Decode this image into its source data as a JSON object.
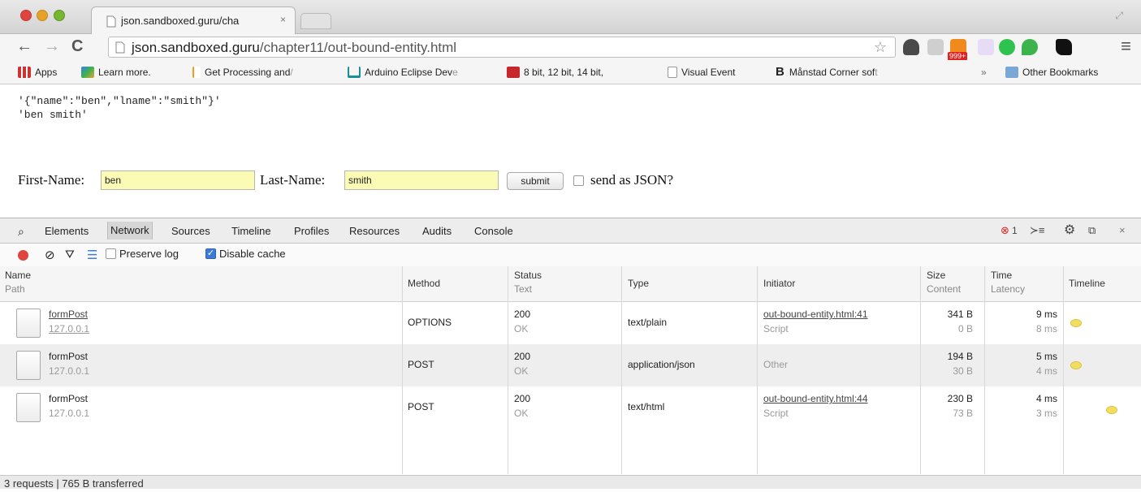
{
  "browser": {
    "tab_title": "json.sandboxed.guru/cha",
    "tab_close": "×",
    "url_host": "json.sandboxed.guru",
    "url_path": "/chapter11/out-bound-entity.html",
    "extension_badge": "999+",
    "extensions": [
      "pocket-icon",
      "linkedin-icon",
      "rss-icon",
      "jetbrains-icon",
      "opera-icon",
      "leaf-icon",
      "pirate-icon"
    ]
  },
  "bookmarks": {
    "apps": "Apps",
    "items": [
      {
        "label": "Learn more.",
        "icon": "puzzle-icon"
      },
      {
        "label": "Get Processing and",
        "fade": " /",
        "icon": "bookmark-icon"
      },
      {
        "label": "Arduino Eclipse Dev",
        "fade": "e",
        "icon": "arduino-icon"
      },
      {
        "label": "8 bit, 12 bit, 14 bit,",
        "icon": "ls-icon"
      },
      {
        "label": "Visual Event",
        "icon": "page-icon"
      },
      {
        "label": "Månstad Corner sof",
        "fade": "t",
        "icon": "b-icon"
      }
    ],
    "overflow": "»",
    "other": "Other Bookmarks"
  },
  "page": {
    "output_line1": "'{\"name\":\"ben\",\"lname\":\"smith\"}'",
    "output_line2": "'ben smith'",
    "first_label": "First-Name:",
    "first_value": "ben",
    "last_label": "Last-Name:",
    "last_value": "smith",
    "submit_label": "submit",
    "json_label": "send as JSON?"
  },
  "devtools": {
    "tabs": [
      "Elements",
      "Network",
      "Sources",
      "Timeline",
      "Profiles",
      "Resources",
      "Audits",
      "Console"
    ],
    "active_tab": "Network",
    "error_count": "1",
    "preserve_log": "Preserve log",
    "disable_cache": "Disable cache",
    "columns": {
      "name": "Name",
      "path": "Path",
      "method": "Method",
      "status": "Status",
      "text": "Text",
      "type": "Type",
      "initiator": "Initiator",
      "size": "Size",
      "content": "Content",
      "time": "Time",
      "latency": "Latency",
      "timeline": "Timeline"
    },
    "rows": [
      {
        "name": "formPost",
        "path": "127.0.0.1",
        "method": "OPTIONS",
        "status": "200",
        "status_text": "OK",
        "type": "text/plain",
        "initiator": "out-bound-entity.html:41",
        "initiator_sub": "Script",
        "size": "341 B",
        "content": "0 B",
        "time": "9 ms",
        "latency": "8 ms"
      },
      {
        "name": "formPost",
        "path": "127.0.0.1",
        "method": "POST",
        "status": "200",
        "status_text": "OK",
        "type": "application/json",
        "initiator": "Other",
        "initiator_sub": "",
        "size": "194 B",
        "content": "30 B",
        "time": "5 ms",
        "latency": "4 ms"
      },
      {
        "name": "formPost",
        "path": "127.0.0.1",
        "method": "POST",
        "status": "200",
        "status_text": "OK",
        "type": "text/html",
        "initiator": "out-bound-entity.html:44",
        "initiator_sub": "Script",
        "size": "230 B",
        "content": "73 B",
        "time": "4 ms",
        "latency": "3 ms"
      }
    ],
    "status_bar": "3 requests | 765 B transferred"
  },
  "colors": {
    "accent_red": "#e0443e",
    "input_highlight": "#fbfbb6",
    "timeline_dot": "#f1de60"
  }
}
